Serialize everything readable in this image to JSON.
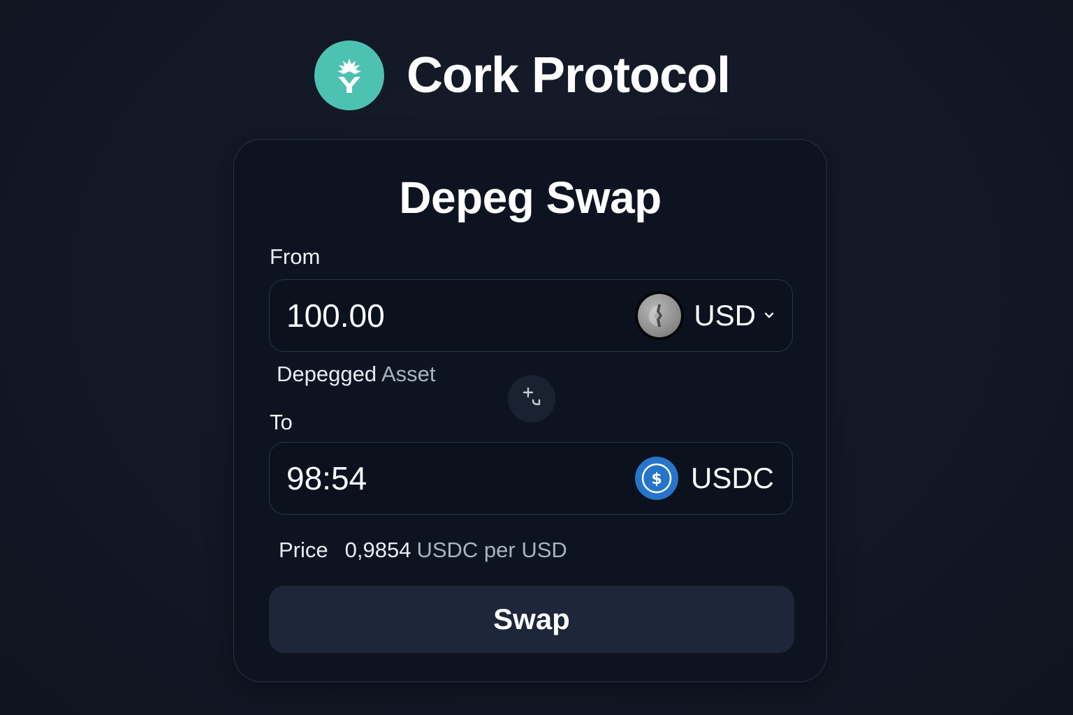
{
  "app": {
    "brand_name": "Cork Protocol",
    "logo_icon": "cork-sprout-icon",
    "accent_color": "#4ec2b2"
  },
  "card": {
    "title": "Depeg Swap",
    "from": {
      "label": "From",
      "amount": "100.00",
      "token": "USD",
      "token_icon": "usd-token-icon",
      "sub_label_primary": "Depegged",
      "sub_label_secondary": "Asset"
    },
    "flip_icon": "swap-direction-icon",
    "to": {
      "label": "To",
      "amount": "98:54",
      "token": "USDC",
      "token_icon": "usdc-token-icon",
      "token_color": "#2775ca"
    },
    "price": {
      "label": "Price",
      "value": "0,9854",
      "unit": "USDC per USD"
    },
    "swap_button": "Swap"
  }
}
